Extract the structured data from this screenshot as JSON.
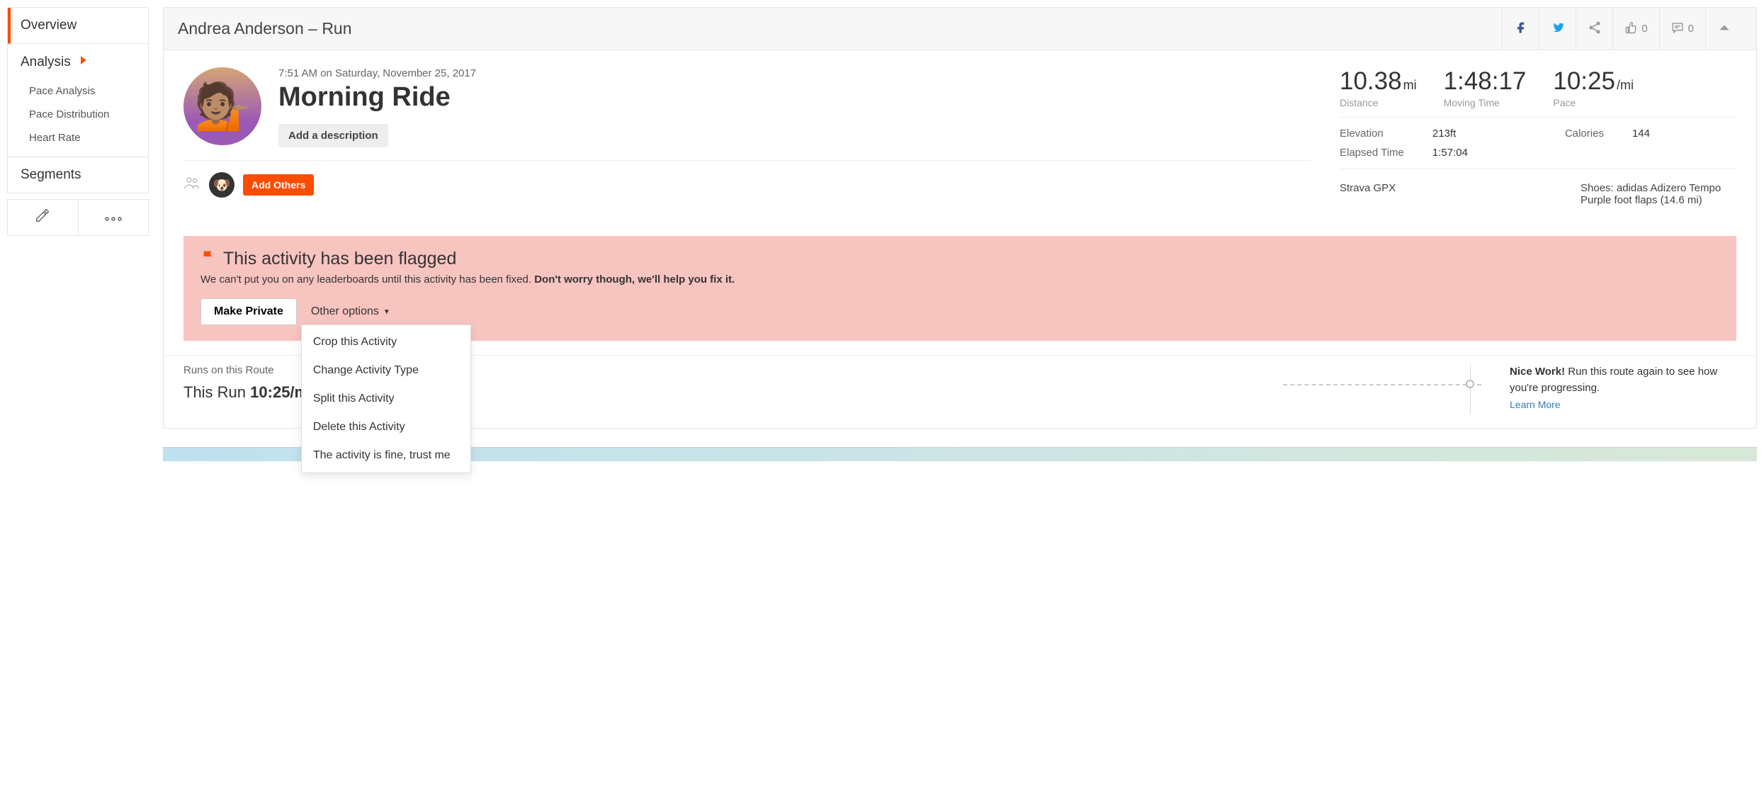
{
  "sidebar": {
    "overview": "Overview",
    "analysis": "Analysis",
    "sub": {
      "pace_analysis": "Pace Analysis",
      "pace_distribution": "Pace Distribution",
      "heart_rate": "Heart Rate"
    },
    "segments": "Segments"
  },
  "header": {
    "title": "Andrea Anderson – Run",
    "kudos_count": "0",
    "comments_count": "0"
  },
  "activity": {
    "timestamp": "7:51 AM on Saturday, November 25, 2017",
    "title": "Morning Ride",
    "add_description": "Add a description",
    "add_others": "Add Others"
  },
  "stats": {
    "distance_val": "10.38",
    "distance_unit": "mi",
    "distance_label": "Distance",
    "moving_val": "1:48:17",
    "moving_label": "Moving Time",
    "pace_val": "10:25",
    "pace_unit": "/mi",
    "pace_label": "Pace",
    "elevation_k": "Elevation",
    "elevation_v": "213ft",
    "calories_k": "Calories",
    "calories_v": "144",
    "elapsed_k": "Elapsed Time",
    "elapsed_v": "1:57:04",
    "gpx": "Strava GPX",
    "shoes": "Shoes: adidas Adizero Tempo Purple foot flaps (14.6 mi)"
  },
  "flag": {
    "title": "This activity has been flagged",
    "msg_plain": "We can't put you on any leaderboards until this activity has been fixed. ",
    "msg_bold": "Don't worry though, we'll help you fix it.",
    "make_private": "Make Private",
    "other_options": "Other options",
    "menu": {
      "crop": "Crop this Activity",
      "change_type": "Change Activity Type",
      "split": "Split this Activity",
      "delete": "Delete this Activity",
      "trust": "The activity is fine, trust me"
    }
  },
  "route": {
    "label": "Runs on this Route",
    "this_prefix": "This Run ",
    "this_pace": "10:25/m",
    "nice_bold": "Nice Work! ",
    "nice_rest": "Run this route again to see how you're progressing.",
    "learn_more": "Learn More"
  }
}
